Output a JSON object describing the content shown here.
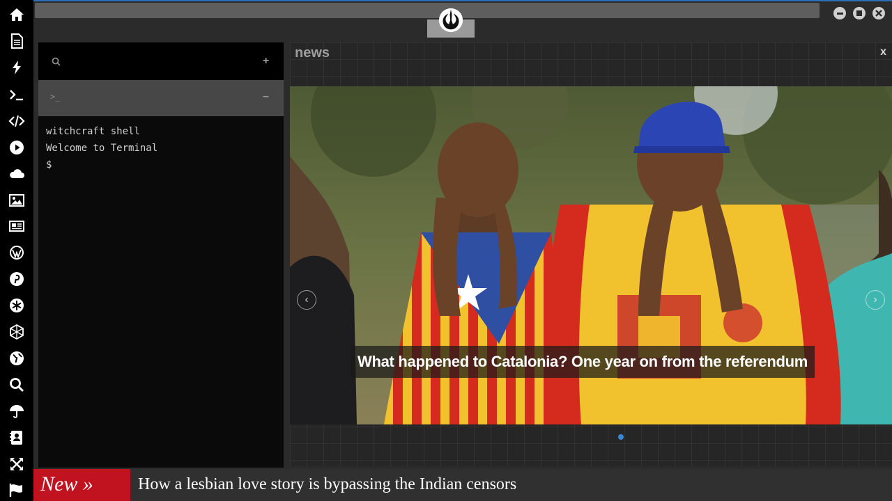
{
  "sidebar": {
    "icons": [
      "home-icon",
      "document-icon",
      "lightning-icon",
      "terminal-icon",
      "code-icon",
      "play-icon",
      "cloud-icon",
      "image-icon",
      "newspaper-icon",
      "wordpress-icon",
      "pinterest-icon",
      "asterisk-icon",
      "network-icon",
      "globe-icon",
      "search-icon",
      "umbrella-icon",
      "contacts-icon",
      "expand-icon",
      "flag-icon"
    ]
  },
  "topbar": {
    "logo_icon": "rebel-alliance-icon",
    "controls": [
      "minimize-icon",
      "maximize-icon",
      "close-icon"
    ]
  },
  "terminal": {
    "search_placeholder": "",
    "add_label": "+",
    "tab_prompt": ">_",
    "tab_collapse": "–",
    "lines": [
      "witchcraft shell",
      "Welcome to Terminal",
      "$"
    ]
  },
  "news": {
    "title": "news",
    "close_label": "x",
    "headline": "What happened to Catalonia? One year on from the referendum",
    "prev_label": "‹",
    "next_label": "›",
    "active_slide": 1,
    "slide_count": 1
  },
  "ticker": {
    "label": "New »",
    "text": "How a lesbian love story is bypassing the Indian censors"
  },
  "colors": {
    "accent": "#2a6fb8",
    "ticker_red": "#c1121f",
    "dot_blue": "#3a86d6"
  }
}
